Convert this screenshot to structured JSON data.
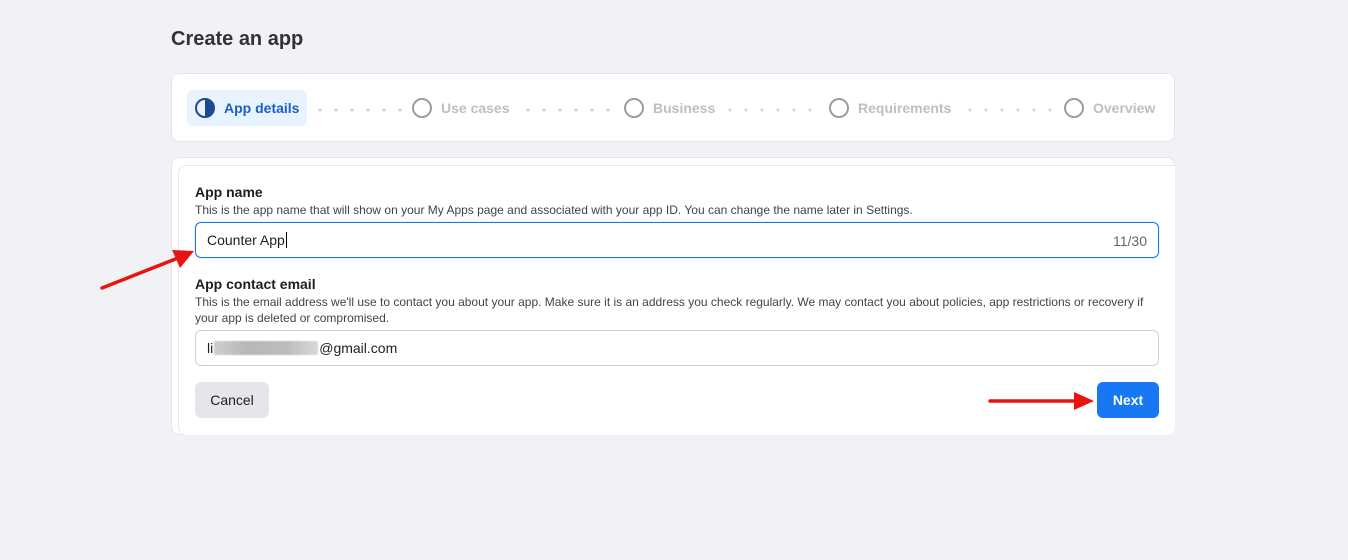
{
  "page": {
    "title": "Create an app"
  },
  "stepper": {
    "steps": [
      {
        "label": "App details",
        "state": "active"
      },
      {
        "label": "Use cases",
        "state": "pending"
      },
      {
        "label": "Business",
        "state": "pending"
      },
      {
        "label": "Requirements",
        "state": "pending"
      },
      {
        "label": "Overview",
        "state": "pending"
      }
    ]
  },
  "form": {
    "app_name": {
      "label": "App name",
      "help": "This is the app name that will show on your My Apps page and associated with your app ID. You can change the name later in Settings.",
      "value": "Counter App",
      "counter": "11/30"
    },
    "contact_email": {
      "label": "App contact email",
      "help": "This is the email address we'll use to contact you about your app. Make sure it is an address you check regularly. We may contact you about policies, app restrictions or recovery if your app is deleted or compromised.",
      "value_prefix": "li",
      "value_suffix": "@gmail.com"
    }
  },
  "actions": {
    "cancel_label": "Cancel",
    "next_label": "Next"
  },
  "colors": {
    "accent": "#1877f2",
    "annotation_arrow": "#e8140f",
    "background": "#f0f2f5"
  }
}
